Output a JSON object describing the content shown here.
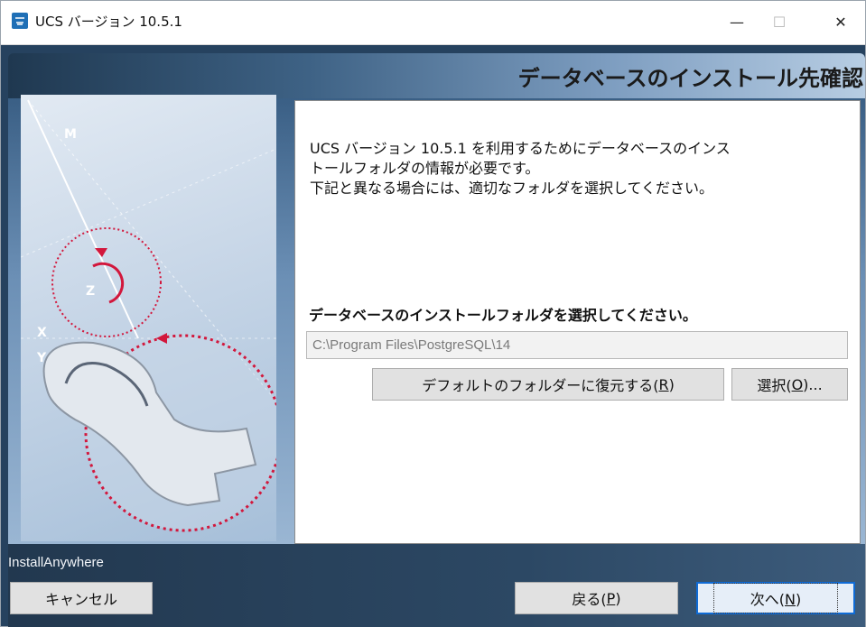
{
  "window": {
    "title": "UCS バージョン 10.5.1",
    "controls": {
      "minimize": "—",
      "maximize": "☐",
      "close": "✕"
    }
  },
  "header": {
    "title": "データベースのインストール先確認"
  },
  "side_art": {
    "labels": {
      "m": "M",
      "z": "Z",
      "x": "X",
      "y": "Y"
    }
  },
  "content": {
    "intro_lines": [
      "UCS バージョン 10.5.1 を利用するためにデータベースのインス",
      "トールフォルダの情報が必要です。",
      "下記と異なる場合には、適切なフォルダを選択してください。"
    ],
    "folder_prompt": "データベースのインストールフォルダを選択してください。",
    "folder_value": "C:\\Program Files\\PostgreSQL\\14",
    "restore_button": {
      "text": "デフォルトのフォルダーに復元する(",
      "mnemonic": "R",
      "suffix": ")"
    },
    "select_button": {
      "text": "選択(",
      "mnemonic": "O",
      "suffix": ")..."
    }
  },
  "footer": {
    "brand": "InstallAnywhere",
    "cancel_button": "キャンセル",
    "back_button": {
      "text": "戻る(",
      "mnemonic": "P",
      "suffix": ")"
    },
    "next_button": {
      "text": "次へ(",
      "mnemonic": "N",
      "suffix": ")"
    }
  },
  "colors": {
    "accent": "#0f6bd6",
    "dotted_red": "#d2173c",
    "frame": "#26425f"
  }
}
